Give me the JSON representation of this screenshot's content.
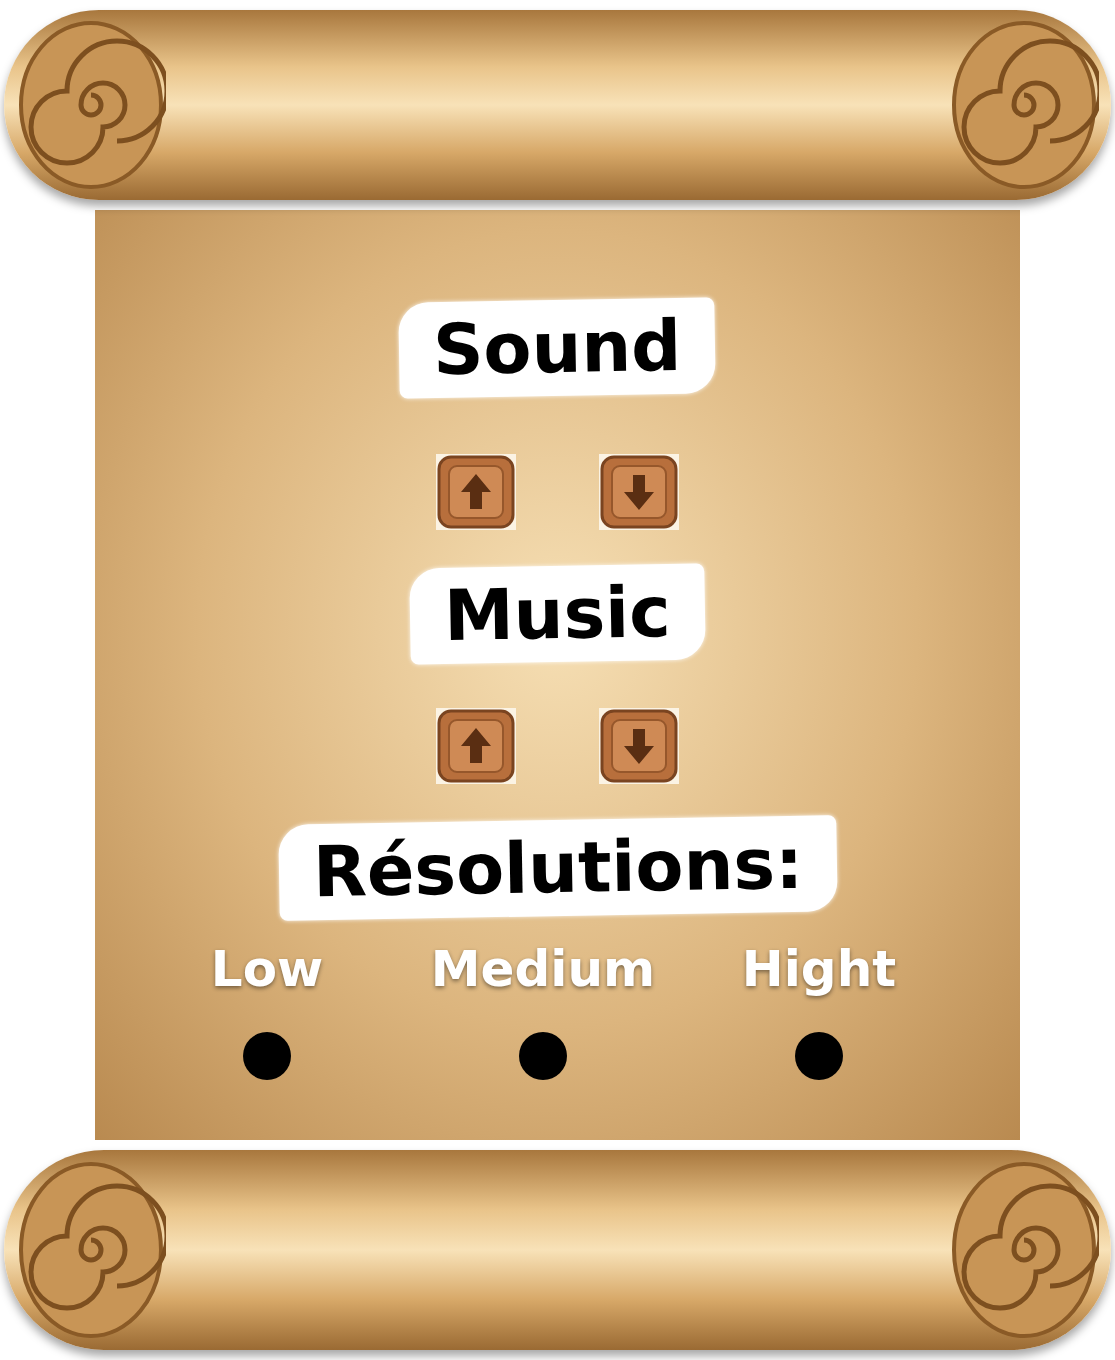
{
  "sound": {
    "label": "Sound",
    "buttons": [
      {
        "direction": "up"
      },
      {
        "direction": "down"
      }
    ]
  },
  "music": {
    "label": "Music",
    "buttons": [
      {
        "direction": "up"
      },
      {
        "direction": "down"
      }
    ]
  },
  "resolutions": {
    "label": "Résolutions:",
    "options": [
      {
        "label": "Low",
        "selected": false
      },
      {
        "label": "Medium",
        "selected": false
      },
      {
        "label": "Hight",
        "selected": false
      }
    ]
  }
}
